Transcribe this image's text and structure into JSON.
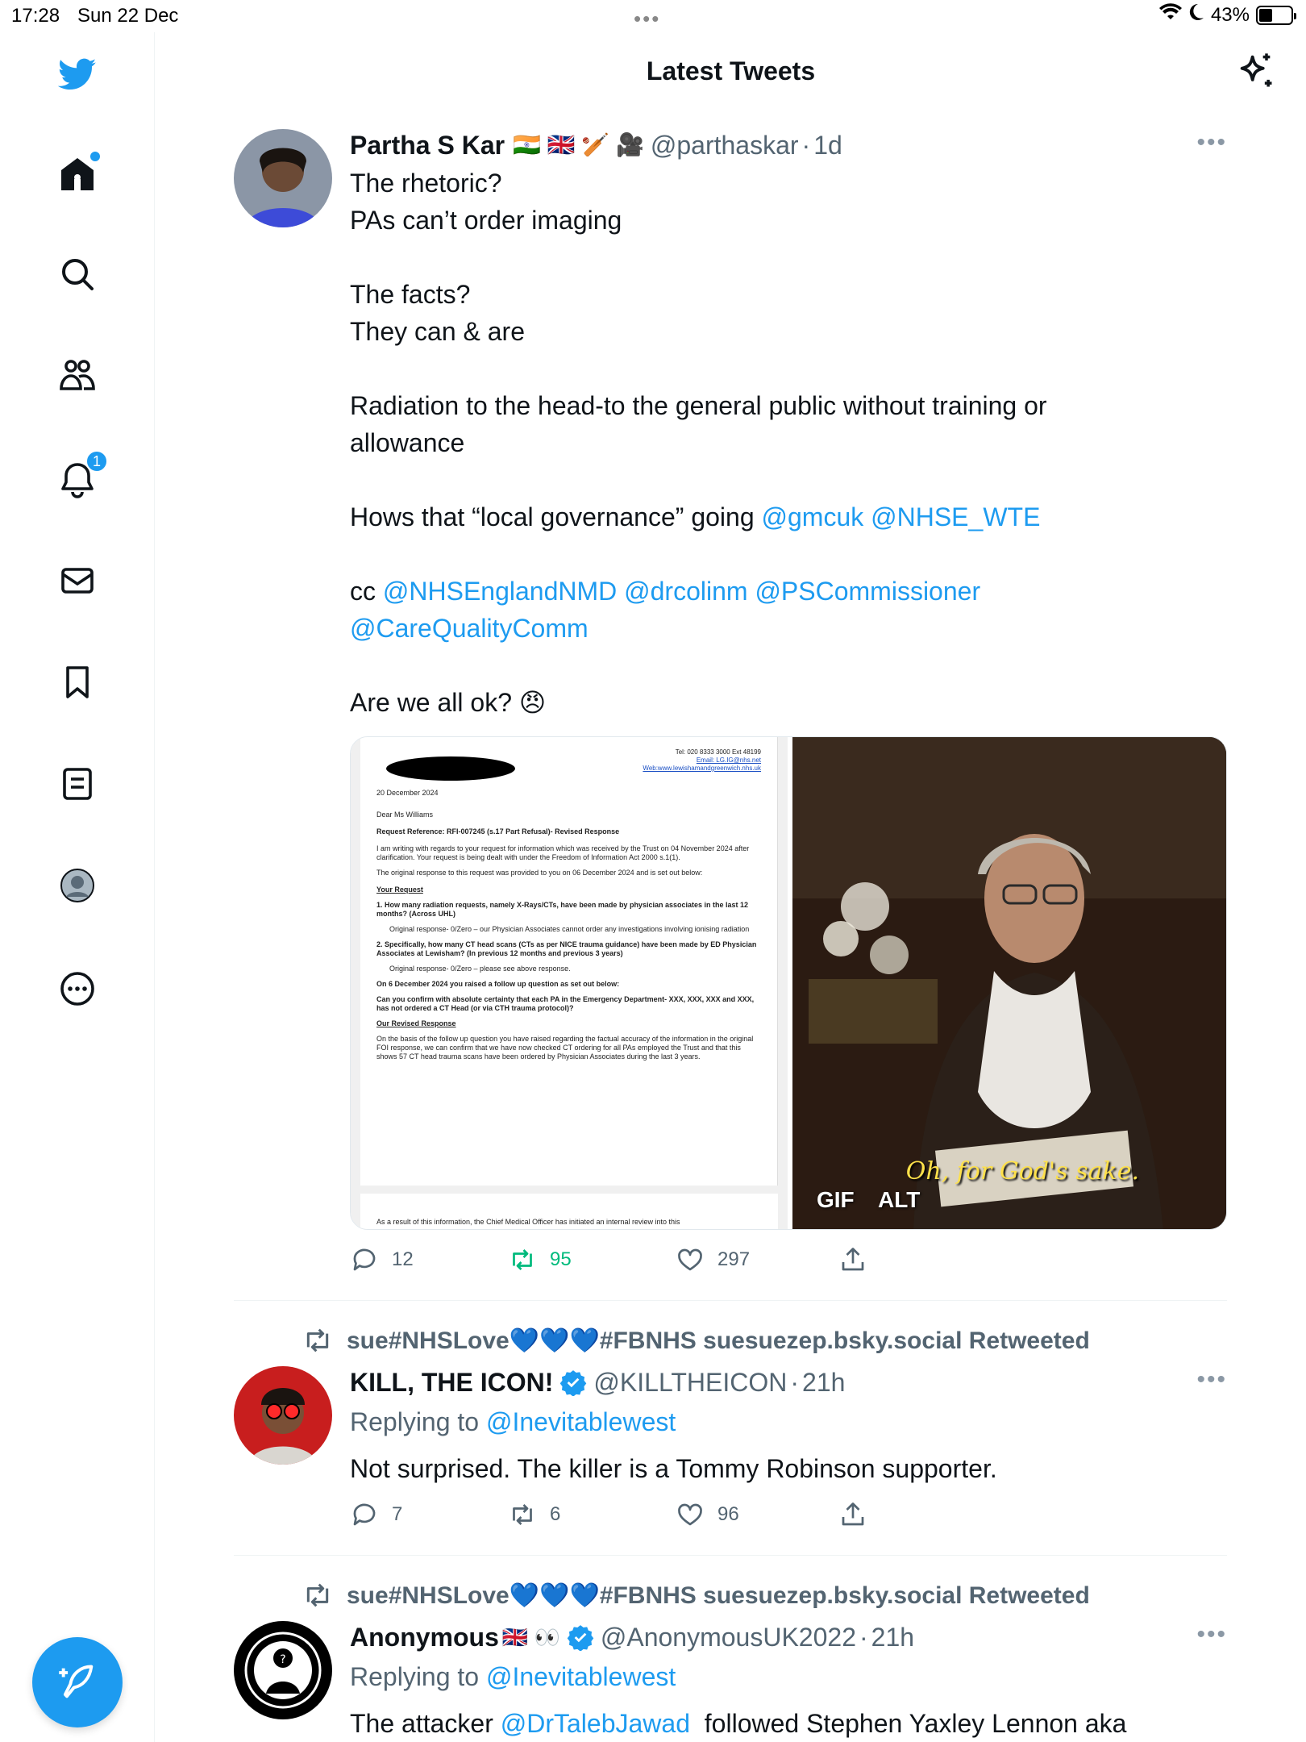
{
  "status_bar": {
    "time": "17:28",
    "date": "Sun 22 Dec",
    "battery": "43%",
    "battery_level": 0.43
  },
  "header": {
    "title": "Latest Tweets"
  },
  "sidebar": {
    "notifications_badge": "1"
  },
  "colors": {
    "accent": "#1d9bf0",
    "retweet_green": "#00ba7c",
    "muted": "#536471"
  },
  "tweets": [
    {
      "name": "Partha S Kar",
      "name_emoji": "🇮🇳 🇬🇧 🏏 🎥",
      "handle": "@parthaskar",
      "time": "1d",
      "lines": [
        "The rhetoric?",
        "PAs can’t order imaging",
        "The facts?",
        "They can & are",
        "Radiation to the head-to the general public without training or",
        "allowance",
        "Hows that “local governance” going ",
        "cc ",
        "Are we all ok? 😠"
      ],
      "mentions_1": [
        "@gmcuk",
        "@NHSE_WTE"
      ],
      "mentions_2": [
        "@NHSEnglandNMD",
        "@drcolinm",
        "@PSCommissioner",
        "@CareQualityComm"
      ],
      "media": {
        "doc": {
          "tel": "Tel: 020 8333 3000 Ext 48199",
          "email": "Email: LG.IG@nhs.net",
          "web": "Web:www.lewishamandgreenwich.nhs.uk",
          "date": "20 December 2024",
          "salutation": "Dear Ms Williams",
          "reference": "Request Reference: RFI-007245 (s.17 Part Refusal)- Revised Response",
          "para1": "I am writing with regards to your request for information which was received by the Trust on 04 November 2024 after clarification. Your request is being dealt with under the Freedom of Information Act 2000 s.1(1).",
          "para2": "The original response to this request was provided to you on 06 December 2024 and is set out below:",
          "your_request": "Your Request",
          "q1": "1.  How many radiation requests, namely X-Rays/CTs, have been made by physician associates in the last 12 months? (Across UHL)",
          "a1": "Original response- 0/Zero – our Physician Associates cannot order any investigations involving ionising radiation",
          "q2": "2.  Specifically, how many CT head scans (CTs as per NICE trauma guidance) have been made by ED Physician Associates at Lewisham? (In previous 12 months and previous 3 years)",
          "a2": "Original response- 0/Zero – please see above response.",
          "followup": "On 6 December 2024 you raised a follow up question as set out below:",
          "followup_q": "Can you confirm with absolute certainty that each PA in the Emergency Department- XXX, XXX, XXX and XXX, has not ordered a CT Head (or via CTH trauma protocol)?",
          "revised": "Our Revised Response",
          "revised_text": "On the basis of the follow up question you have raised regarding the factual accuracy of the information in the original FOI response, we can confirm that we have now checked CT ordering for all PAs employed the Trust and that this shows 57 CT head trauma scans have been ordered by Physician Associates during the last 3 years.",
          "page2": "As a result of this information, the Chief Medical Officer has initiated an internal review into this"
        },
        "gif_caption": "Oh, for God's sake.",
        "gif_label": "GIF",
        "alt_label": "ALT"
      },
      "replies": "12",
      "retweets": "95",
      "likes": "297"
    },
    {
      "retweeted_by": "sue#NHSLove💙💙💙#FBNHS suesuezep.bsky.social Retweeted",
      "name": "KILL, THE ICON!",
      "handle": "@KILLTHEICON",
      "time": "21h",
      "replying_label": "Replying to ",
      "replying_to": "@Inevitablewest",
      "text": "Not surprised. The killer is a Tommy Robinson supporter.",
      "replies": "7",
      "retweets": "6",
      "likes": "96"
    },
    {
      "retweeted_by": "sue#NHSLove💙💙💙#FBNHS suesuezep.bsky.social Retweeted",
      "name": "Anonymous",
      "name_emoji": "🇬🇧 👀",
      "handle": "@AnonymousUK2022",
      "time": "21h",
      "replying_label": "Replying to ",
      "replying_to": "@Inevitablewest",
      "text_prefix": "The attacker ",
      "text_mention": "@DrTalebJawad",
      "text_suffix": "  followed Stephen Yaxley Lennon aka"
    }
  ]
}
